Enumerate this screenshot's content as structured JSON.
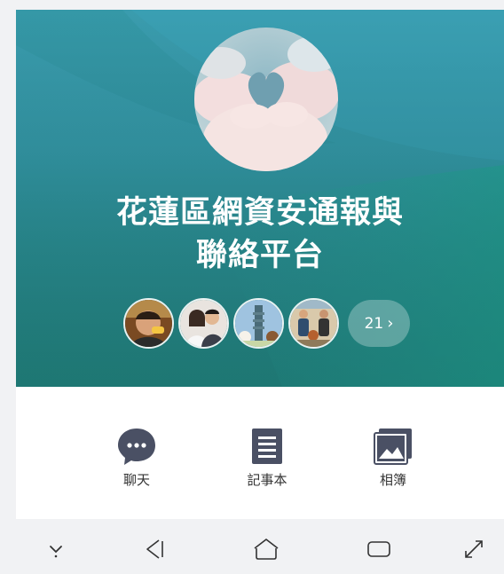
{
  "group": {
    "name_line1": "花蓮區網資安通報與",
    "name_line2": "聯絡平台",
    "member_more_count": "21",
    "member_more_chevron": "›",
    "avatar_icon": "cloud-heart-photo"
  },
  "members": [
    {
      "icon": "member-photo-man"
    },
    {
      "icon": "member-photo-couple"
    },
    {
      "icon": "member-photo-tower"
    },
    {
      "icon": "member-photo-group"
    }
  ],
  "actions": [
    {
      "label": "聊天",
      "icon": "chat-bubble-icon"
    },
    {
      "label": "記事本",
      "icon": "notes-icon"
    },
    {
      "label": "相簿",
      "icon": "album-icon"
    }
  ],
  "navbar": {
    "items": [
      "hide-keyboard-icon",
      "back-icon",
      "home-icon",
      "recents-icon",
      "expand-icon"
    ]
  },
  "colors": {
    "cover_top": "#3a9cae",
    "cover_bottom": "#24807c",
    "icon_dark": "#4a5064",
    "background": "#f1f2f4"
  }
}
